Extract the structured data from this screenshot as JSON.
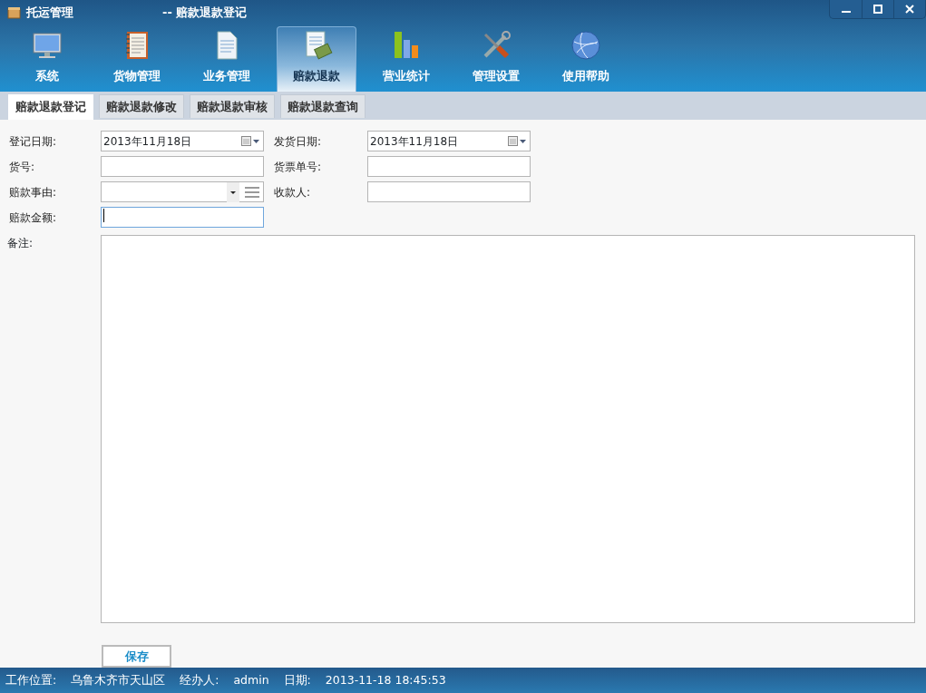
{
  "window": {
    "title": "托运管理",
    "subtitle": "--  赔款退款登记"
  },
  "toolbar": [
    {
      "label": "系统",
      "selected": false
    },
    {
      "label": "货物管理",
      "selected": false
    },
    {
      "label": "业务管理",
      "selected": false
    },
    {
      "label": "赔款退款",
      "selected": true
    },
    {
      "label": "营业统计",
      "selected": false
    },
    {
      "label": "管理设置",
      "selected": false
    },
    {
      "label": "使用帮助",
      "selected": false
    }
  ],
  "subtabs": [
    {
      "label": "赔款退款登记",
      "selected": true
    },
    {
      "label": "赔款退款修改",
      "selected": false
    },
    {
      "label": "赔款退款审核",
      "selected": false
    },
    {
      "label": "赔款退款查询",
      "selected": false
    }
  ],
  "form": {
    "fields": [
      {
        "label": "登记日期:",
        "kind": "date",
        "value": "2013年11月18日",
        "focused": false
      },
      {
        "label": "发货日期:",
        "kind": "date",
        "value": "2013年11月18日",
        "focused": false
      },
      {
        "label": "货号:",
        "kind": "text",
        "focused": false
      },
      {
        "label": "货票单号:",
        "kind": "text",
        "focused": false
      },
      {
        "label": "赔款事由:",
        "kind": "combo",
        "focused": false
      },
      {
        "label": "收款人:",
        "kind": "text",
        "focused": false
      },
      {
        "label": "赔款金额:",
        "kind": "text",
        "focused": true
      }
    ],
    "remarks_label": "备注:",
    "save_button": "保存"
  },
  "status_bar": [
    {
      "label": "工作位置:",
      "value": "乌鲁木齐市天山区"
    },
    {
      "label": "经办人:",
      "value": "admin"
    },
    {
      "label": "日期:",
      "value": "2013-11-18 18:45:53"
    }
  ]
}
